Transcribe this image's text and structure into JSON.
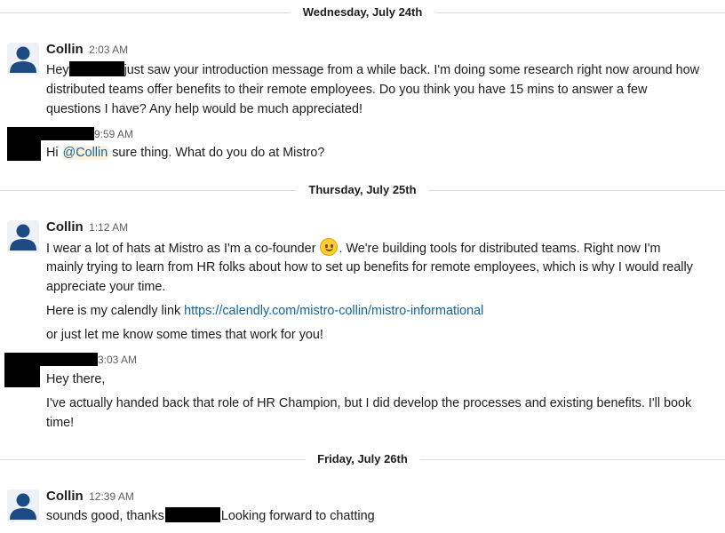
{
  "dates": {
    "d1": "Wednesday, July 24th",
    "d2": "Thursday, July 25th",
    "d3": "Friday, July 26th"
  },
  "messages": {
    "m1": {
      "author": "Collin",
      "time": "2:03 AM",
      "line1_pre": "Hey",
      "line1_post": "just saw your introduction message from a while back. I'm doing some research right now around how",
      "line2": "distributed teams offer benefits to their remote employees. Do you think you have 15 mins to answer a few",
      "line3": "questions I have? Any help would be much appreciated!"
    },
    "m2": {
      "time": "9:59 AM",
      "pre": "Hi",
      "mention": "@Collin",
      "post": "sure thing. What do you do at Mistro?"
    },
    "m3": {
      "author": "Collin",
      "time": "1:12 AM",
      "line1_pre": "I wear a lot of hats at Mistro as I'm a co-founder",
      "emoji": "slightly-smiling-face",
      "line1_post": ".  We're building tools for distributed teams. Right now I'm",
      "line2": "mainly trying to learn from HR folks about how to set up benefits for remote employees, which is why I would really",
      "line3": "appreciate your time.",
      "link_pre": "Here is my calendly link",
      "link": "https://calendly.com/mistro-collin/mistro-informational",
      "line5": "or just let me know some times that work for you!"
    },
    "m4": {
      "time": "3:03 AM",
      "line1": "Hey there,",
      "line2": "I've actually handed back that role of HR Champion, but I did develop the processes and existing benefits. I'll book",
      "line3": "time!"
    },
    "m5": {
      "author": "Collin",
      "time": "12:39 AM",
      "pre": "sounds good, thanks",
      "post": "Looking forward to chatting"
    }
  },
  "icons": {
    "avatar": "person-silhouette-icon",
    "emoji": "slightly-smiling-face-emoji"
  },
  "colors": {
    "link": "#1264a3",
    "avatar": "#1d4a84",
    "mention_bg": "#fdf3dc",
    "divider": "#dddddd"
  }
}
